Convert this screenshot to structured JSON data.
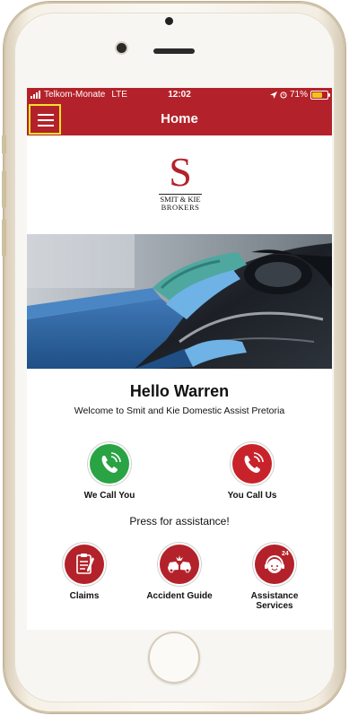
{
  "status": {
    "carrier": "Telkom-Monate",
    "network": "LTE",
    "time": "12:02",
    "battery": "71%",
    "battery_level": 0.71
  },
  "header": {
    "title": "Home",
    "menu_icon": "hamburger-menu-icon"
  },
  "logo": {
    "letter": "S",
    "line1": "SMIT & KIE",
    "line2": "BROKERS"
  },
  "main": {
    "greeting": "Hello Warren",
    "welcome": "Welcome to Smit and Kie Domestic Assist Pretoria",
    "press_text": "Press for assistance!"
  },
  "call_actions": [
    {
      "label": "We Call You",
      "icon": "phone-icon",
      "color": "#2aa344"
    },
    {
      "label": "You Call Us",
      "icon": "phone-icon",
      "color": "#c8232b"
    }
  ],
  "assist_actions": [
    {
      "label": "Claims",
      "icon": "clipboard-icon"
    },
    {
      "label": "Accident Guide",
      "icon": "car-crash-icon"
    },
    {
      "label_line1": "Assistance",
      "label_line2": "Services",
      "icon": "support-agent-24-icon",
      "badge": "24"
    }
  ],
  "colors": {
    "brand_red": "#b3222a",
    "call_green": "#2aa344",
    "menu_highlight": "#f3e22a"
  }
}
